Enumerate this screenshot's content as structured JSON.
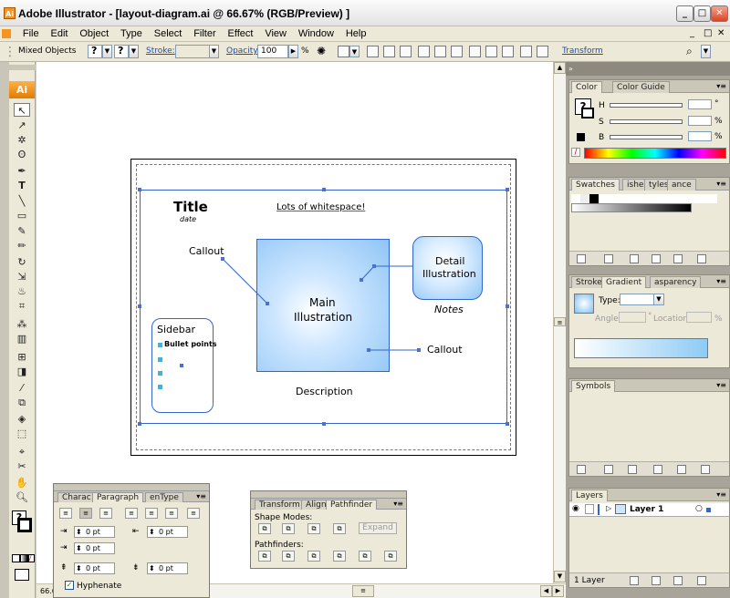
{
  "window": {
    "title": "Adobe Illustrator - [layout-diagram.ai @ 66.67% (RGB/Preview) ]",
    "app_icon": "Ai",
    "buttons": [
      "_",
      "□",
      "✕"
    ]
  },
  "menu": {
    "items": [
      "File",
      "Edit",
      "Object",
      "Type",
      "Select",
      "Filter",
      "Effect",
      "View",
      "Window",
      "Help"
    ],
    "doc_buttons": [
      "_",
      "□",
      "✕"
    ]
  },
  "control": {
    "selection_label": "Mixed Objects",
    "stroke_label": "Stroke:",
    "opacity_label": "Opacity:",
    "opacity_value": "100",
    "percent": "%",
    "transform_label": "Transform",
    "qmark": "?"
  },
  "toolbox": {
    "logo": "Ai",
    "tools": [
      "selection-tool",
      "direct-selection-tool",
      "magic-wand-tool",
      "lasso-tool",
      "pen-tool",
      "type-tool",
      "line-tool",
      "rectangle-tool",
      "paintbrush-tool",
      "pencil-tool",
      "rotate-tool",
      "scale-tool",
      "warp-tool",
      "free-transform-tool",
      "symbol-sprayer-tool",
      "column-graph-tool",
      "mesh-tool",
      "gradient-tool",
      "eyedropper-tool",
      "blend-tool",
      "live-paint-tool",
      "live-paint-selection-tool",
      "crop-tool",
      "scissors-tool",
      "hand-tool",
      "zoom-tool"
    ]
  },
  "artboard": {
    "title": "Title",
    "date": "date",
    "whitespace": "Lots of whitespace!",
    "callout1": "Callout",
    "callout2": "Callout",
    "main_line1": "Main",
    "main_line2": "Illustration",
    "detail_line1": "Detail",
    "detail_line2": "Illustration",
    "notes": "Notes",
    "sidebar": "Sidebar",
    "bullets": "Bullet points",
    "description": "Description"
  },
  "status": {
    "zoom": "66.6"
  },
  "color_panel": {
    "tabs": [
      "Color",
      "Color Guide"
    ],
    "h": "H",
    "s": "S",
    "b": "B",
    "deg": "°",
    "pct": "%"
  },
  "swatches_panel": {
    "tabs": [
      "Swatches",
      "ishes",
      "tyles",
      "ance"
    ]
  },
  "gradient_panel": {
    "tabs": [
      "Stroke",
      "Gradient",
      "asparency"
    ],
    "type_label": "Type:",
    "angle_label": "Angle:",
    "location_label": "Location:",
    "deg": "°",
    "pct": "%"
  },
  "symbols_panel": {
    "tabs": [
      "Symbols"
    ]
  },
  "layers_panel": {
    "tabs": [
      "Layers"
    ],
    "layer_name": "Layer 1",
    "footer": "1 Layer"
  },
  "paragraph_panel": {
    "tabs": [
      "Charac",
      "Paragraph",
      "enType"
    ],
    "fields": [
      "0 pt",
      "0 pt",
      "0 pt",
      "0 pt",
      "0 pt"
    ],
    "hyphenate": "Hyphenate"
  },
  "pathfinder_panel": {
    "tabs": [
      "Transform",
      "Align",
      "Pathfinder"
    ],
    "shape_modes": "Shape Modes:",
    "expand": "Expand",
    "pathfinders": "Pathfinders:"
  },
  "colors": {
    "accent": "#3366cc",
    "gradient_light": "#e8f4ff",
    "gradient_dark": "#8ec5f5",
    "bullet": "#3ab4e6"
  }
}
